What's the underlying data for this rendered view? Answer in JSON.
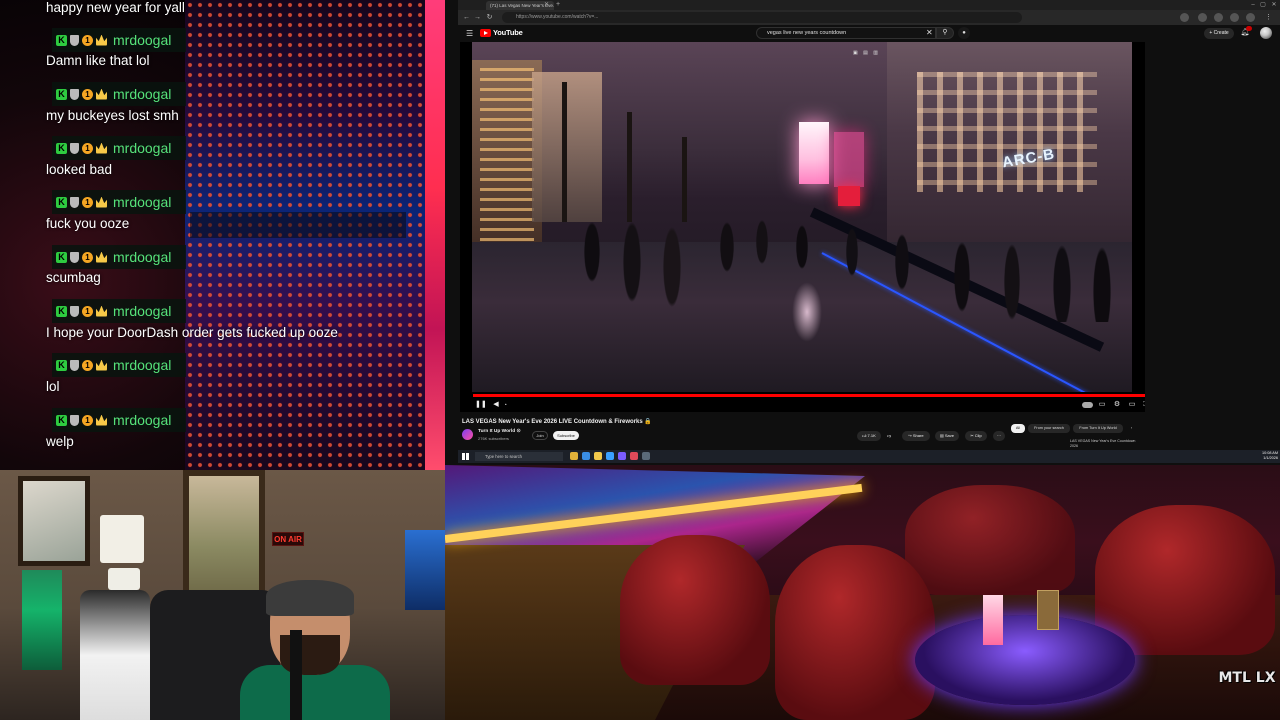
{
  "chat": {
    "top_message": "happy new year for yall",
    "username": "mrdoogal",
    "messages": [
      "Damn like that lol",
      "my buckeyes lost smh",
      "looked bad",
      "fuck you ooze",
      "scumbag",
      "I hope your DoorDash order gets fucked up ooze",
      "lol",
      "welp"
    ],
    "colors": {
      "username": "#56e27a",
      "message": "#ffffff"
    }
  },
  "webcam": {
    "on_air_sign": "ON AIR"
  },
  "browser": {
    "tab_title": "(71) Las Vegas New Year's Eve...",
    "url": "https://www.youtube.com/watch?v=..."
  },
  "youtube": {
    "logo_text": "YouTube",
    "search_query": "vegas live new years countdown",
    "create_label": "Create",
    "video_title": "LAS VEGAS New Year's Eve 2026 LIVE Countdown & Fireworks 🔒",
    "channel_name": "Turn It Up World ⊙",
    "channel_subs": "276K subscribers",
    "join_label": "Join",
    "subscribe_label": "Subscribe",
    "like_count": "7.1K",
    "share_label": "Share",
    "save_label": "Save",
    "clip_label": "Clip",
    "chips": [
      "All",
      "From your search",
      "From Turn It Up World"
    ],
    "recommended_title": "LAS VEGAS New Year's Eve Countdown 2026",
    "video_sign": "ARC-B",
    "progress": 1.0,
    "accent": "#ff0000"
  },
  "taskbar": {
    "search_placeholder": "Type here to search",
    "clock_time": "10:08 AM",
    "clock_date": "1/1/2026"
  },
  "lounge": {
    "watermark": "MTL LX"
  }
}
